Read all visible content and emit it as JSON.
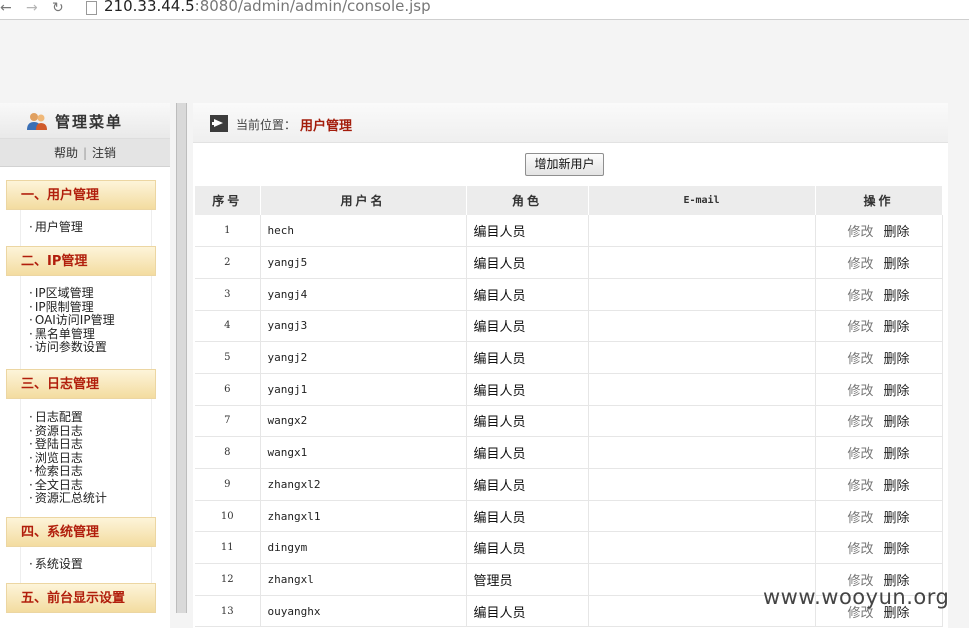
{
  "browser": {
    "url_host": "210.33.44.5",
    "url_rest": ":8080/admin/admin/console.jsp"
  },
  "menu": {
    "title": "管理菜单",
    "help": "帮助",
    "separator": "|",
    "logout": "注销",
    "sections": [
      {
        "title": "一、用户管理",
        "items": [
          "用户管理"
        ]
      },
      {
        "title": "二、IP管理",
        "items": [
          "IP区域管理",
          "IP限制管理",
          "OAI访问IP管理",
          "黑名单管理",
          "访问参数设置"
        ]
      },
      {
        "title": "三、日志管理",
        "items": [
          "日志配置",
          "资源日志",
          "登陆日志",
          "浏览日志",
          "检索日志",
          "全文日志",
          "资源汇总统计"
        ]
      },
      {
        "title": "四、系统管理",
        "items": [
          "系统设置"
        ]
      },
      {
        "title": "五、前台显示设置",
        "items": []
      }
    ]
  },
  "breadcrumb": {
    "label": "当前位置：",
    "current": "用户管理"
  },
  "add_button": "增加新用户",
  "table": {
    "headers": [
      "序号",
      "用户名",
      "角色",
      "E-mail",
      "操作"
    ],
    "rows": [
      {
        "seq": "1",
        "username": "hech",
        "role": "编目人员",
        "email": ""
      },
      {
        "seq": "2",
        "username": "yangj5",
        "role": "编目人员",
        "email": ""
      },
      {
        "seq": "3",
        "username": "yangj4",
        "role": "编目人员",
        "email": ""
      },
      {
        "seq": "4",
        "username": "yangj3",
        "role": "编目人员",
        "email": ""
      },
      {
        "seq": "5",
        "username": "yangj2",
        "role": "编目人员",
        "email": ""
      },
      {
        "seq": "6",
        "username": "yangj1",
        "role": "编目人员",
        "email": ""
      },
      {
        "seq": "7",
        "username": "wangx2",
        "role": "编目人员",
        "email": ""
      },
      {
        "seq": "8",
        "username": "wangx1",
        "role": "编目人员",
        "email": ""
      },
      {
        "seq": "9",
        "username": "zhangxl2",
        "role": "编目人员",
        "email": ""
      },
      {
        "seq": "10",
        "username": "zhangxl1",
        "role": "编目人员",
        "email": ""
      },
      {
        "seq": "11",
        "username": "dingym",
        "role": "编目人员",
        "email": ""
      },
      {
        "seq": "12",
        "username": "zhangxl",
        "role": "管理员",
        "email": ""
      },
      {
        "seq": "13",
        "username": "ouyanghx",
        "role": "编目人员",
        "email": ""
      }
    ],
    "edit_label": "修改",
    "delete_label": "删除"
  },
  "watermark": "www.wooyun.org",
  "colors": {
    "accent_red": "#a31c0b",
    "section_bg": "#f3dca0",
    "header_bg": "#ececec"
  }
}
